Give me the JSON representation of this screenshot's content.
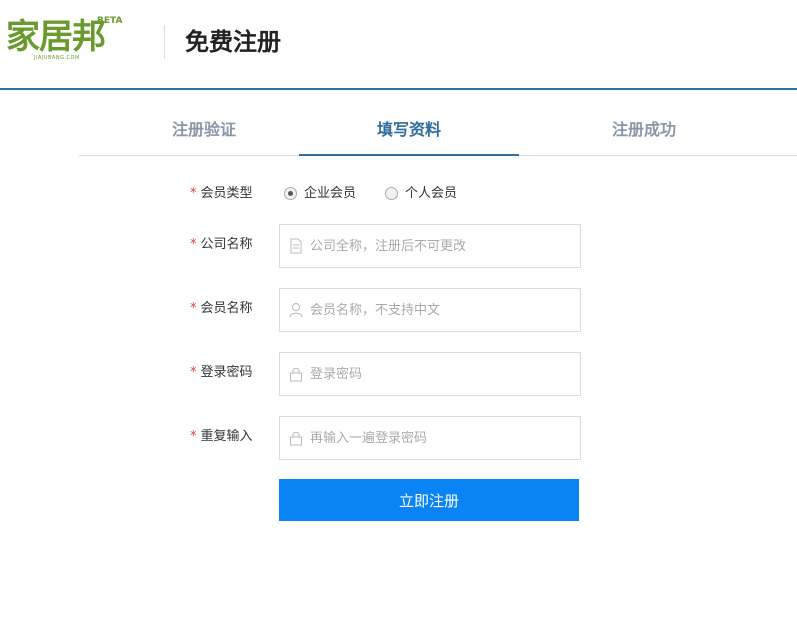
{
  "header": {
    "logo_text": "家居邦",
    "logo_sub": "JIAJUBANG.COM",
    "beta": "BETA",
    "title": "免费注册"
  },
  "steps": [
    {
      "label": "注册验证",
      "active": false
    },
    {
      "label": "填写资料",
      "active": true
    },
    {
      "label": "注册成功",
      "active": false
    }
  ],
  "form": {
    "required_mark": "*",
    "member_type": {
      "label": "会员类型",
      "options": [
        {
          "label": "企业会员",
          "selected": true
        },
        {
          "label": "个人会员",
          "selected": false
        }
      ]
    },
    "company_name": {
      "label": "公司名称",
      "placeholder": "公司全称，注册后不可更改",
      "icon": "document-icon"
    },
    "member_name": {
      "label": "会员名称",
      "placeholder": "会员名称，不支持中文",
      "icon": "user-icon"
    },
    "password": {
      "label": "登录密码",
      "placeholder": "登录密码",
      "icon": "lock-icon"
    },
    "password_repeat": {
      "label": "重复输入",
      "placeholder": "再输入一遍登录密码",
      "icon": "lock-icon"
    },
    "submit_label": "立即注册"
  },
  "colors": {
    "brand_green": "#6a9a2e",
    "accent_blue": "#2f6e9e",
    "button_blue": "#0a84f5",
    "required_red": "#e4393c"
  }
}
